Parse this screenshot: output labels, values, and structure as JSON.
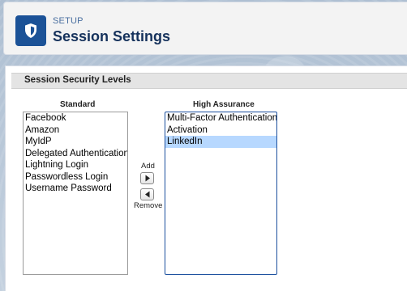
{
  "header": {
    "eyebrow": "SETUP",
    "title": "Session Settings",
    "icon": "shield-icon",
    "icon_color": "#1b5297"
  },
  "section": {
    "title": "Session Security Levels"
  },
  "standard": {
    "label": "Standard",
    "items": [
      "Facebook",
      "Amazon",
      "MyIdP",
      "Delegated Authentication",
      "Lightning Login",
      "Passwordless Login",
      "Username Password"
    ]
  },
  "controls": {
    "add_label": "Add",
    "remove_label": "Remove",
    "add_icon": "triangle-right-icon",
    "remove_icon": "triangle-left-icon"
  },
  "high": {
    "label": "High Assurance",
    "items": [
      "Multi-Factor Authentication",
      "Activation",
      "LinkedIn"
    ],
    "selected": "LinkedIn",
    "selected_color": "#b7d8ff"
  }
}
